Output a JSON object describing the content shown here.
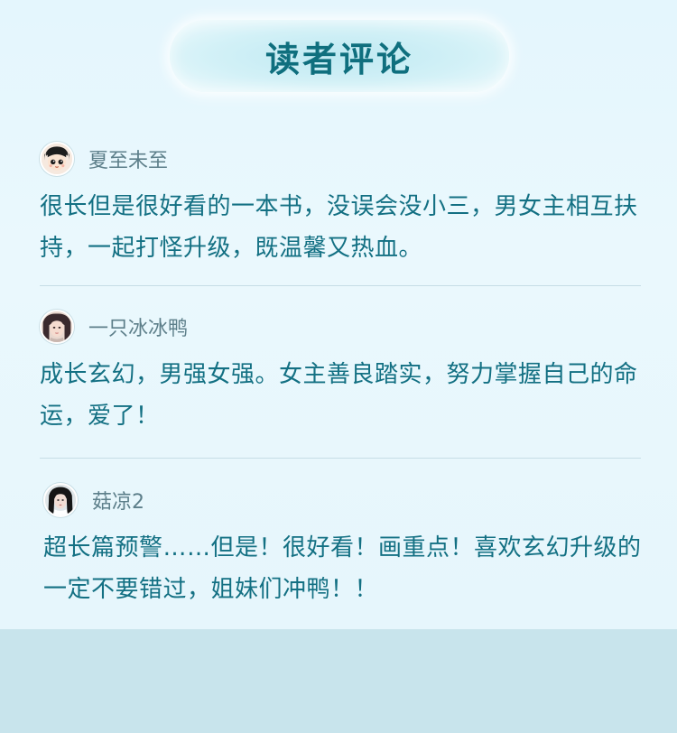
{
  "title": "读者评论",
  "reviews": [
    {
      "username": "夏至未至",
      "avatar_icon": "cartoon-face-avatar-icon",
      "content": "很长但是很好看的一本书，没误会没小三，男女主相互扶持，一起打怪升级，既温馨又热血。"
    },
    {
      "username": "一只冰冰鸭",
      "avatar_icon": "anime-girl-avatar-icon",
      "content": "成长玄幻，男强女强。女主善良踏实，努力掌握自己的命运，爱了！"
    },
    {
      "username": "菇凉2",
      "avatar_icon": "girl-photo-avatar-icon",
      "content": "超长篇预警……但是！很好看！画重点！喜欢玄幻升级的一定不要错过，姐妹们冲鸭！！"
    }
  ]
}
